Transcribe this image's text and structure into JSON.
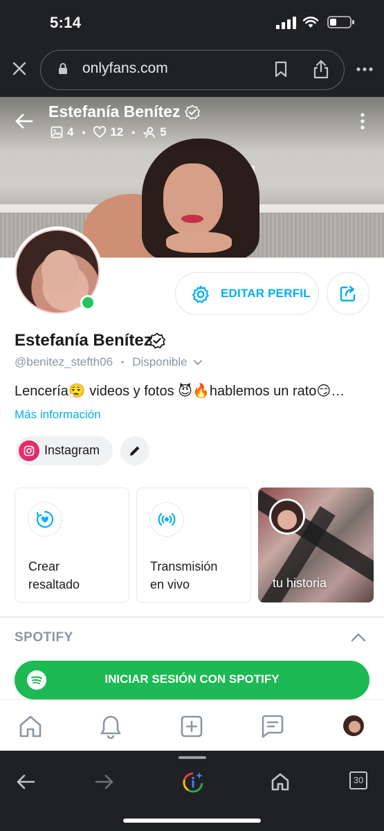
{
  "status": {
    "time": "5:14"
  },
  "browser": {
    "url": "onlyfans.com",
    "tab_count": "30"
  },
  "header": {
    "name": "Estefanía Benítez",
    "stats": {
      "media": "4",
      "likes": "12",
      "fans": "5"
    }
  },
  "profile": {
    "name": "Estefanía Benítez",
    "handle": "@benitez_stefth06",
    "availability": "Disponible",
    "bio": "Lencería😮‍💨 videos y fotos 😈🔥hablemos un rato😏…",
    "more_info": "Más información",
    "edit_label": "EDITAR PERFIL"
  },
  "links": {
    "instagram_label": "Instagram"
  },
  "cards": [
    {
      "label_line1": "Crear",
      "label_line2": "resaltado"
    },
    {
      "label_line1": "Transmisión",
      "label_line2": "en vivo"
    },
    {
      "label": "tu historia"
    }
  ],
  "spotify": {
    "section_title": "SPOTIFY",
    "button_label": "INICIAR SESIÓN CON SPOTIFY"
  },
  "colors": {
    "brand": "#00aff0",
    "spotify": "#1db954",
    "online": "#22c55e",
    "muted": "#8a96a3"
  },
  "icons": {
    "tabbar": [
      "home-icon",
      "bell-icon",
      "add-post-icon",
      "messages-icon",
      "profile-avatar"
    ],
    "browser_bottom": [
      "back-arrow-icon",
      "forward-arrow-icon",
      "google-lens-icon",
      "home-icon",
      "tabs-icon"
    ]
  }
}
